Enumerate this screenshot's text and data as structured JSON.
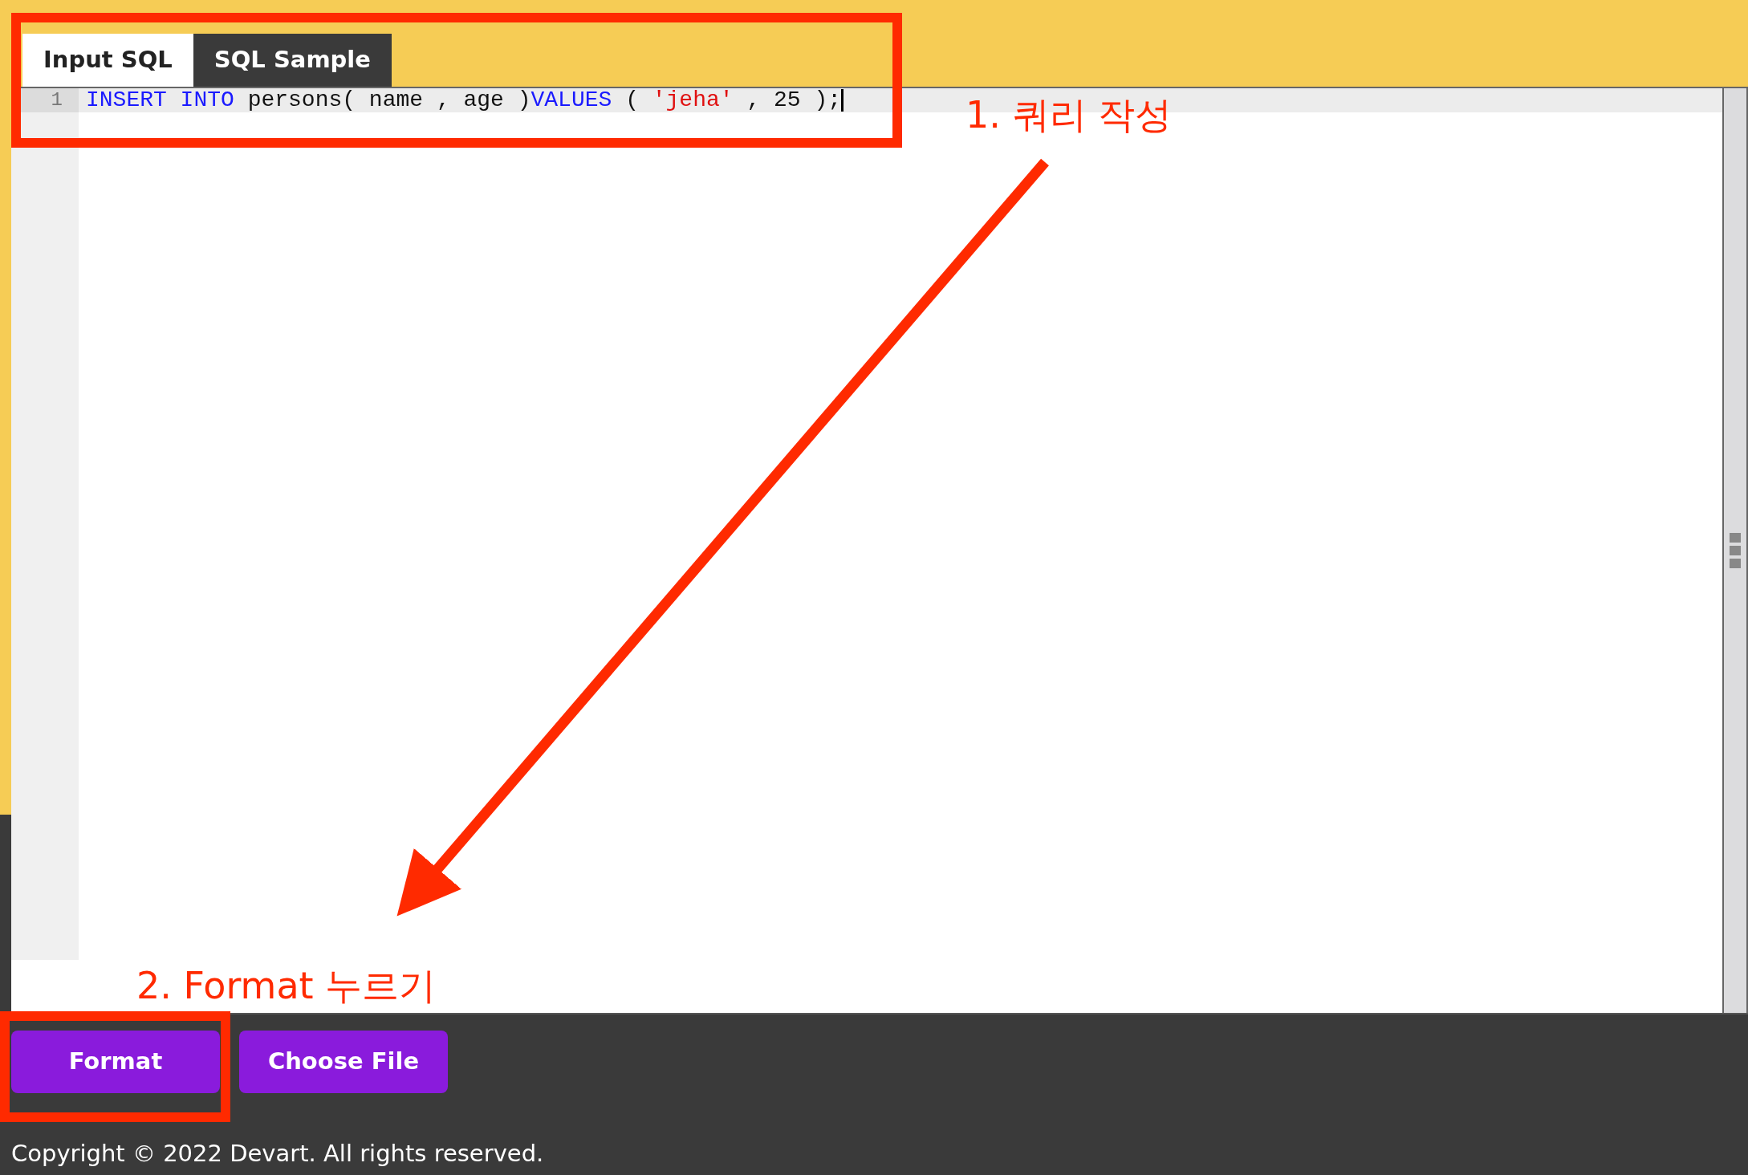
{
  "tabs": [
    {
      "label": "Input SQL",
      "selected": true
    },
    {
      "label": "SQL Sample",
      "selected": false
    }
  ],
  "editor": {
    "lines": [
      {
        "number": "1",
        "active": true,
        "tokens": [
          {
            "kind": "keyword",
            "text": "INSERT INTO"
          },
          {
            "kind": "plain",
            "text": " persons( name , age )"
          },
          {
            "kind": "keyword",
            "text": "VALUES"
          },
          {
            "kind": "plain",
            "text": " ( "
          },
          {
            "kind": "string",
            "text": "'jeha'"
          },
          {
            "kind": "plain",
            "text": " , 25 );"
          }
        ]
      }
    ]
  },
  "buttons": [
    "Format",
    "Choose File"
  ],
  "footer": "Copyright © 2022 Devart. All rights reserved.",
  "annotations": [
    {
      "text": "1. 쿼리 작성"
    },
    {
      "text": "2. Format 누르기"
    }
  ]
}
